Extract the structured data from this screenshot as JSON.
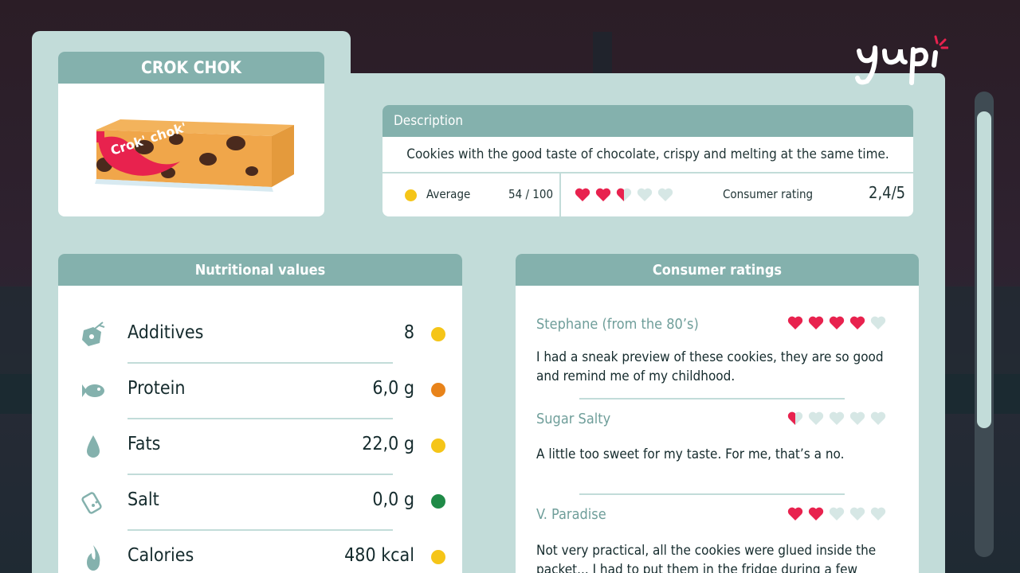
{
  "product": {
    "name": "CROK CHOK",
    "packaging_text": "Crok' chok'"
  },
  "logo": "yupi",
  "description": {
    "header": "Description",
    "text": "Cookies with the good taste of chocolate, crispy and melting at the same time.",
    "score_label": "Average",
    "score_value": "54 / 100",
    "score_color": "#f5c518",
    "consumer_rating_label": "Consumer rating",
    "consumer_rating_value": "2,4/5",
    "hearts": [
      1,
      1,
      0.5,
      0,
      0
    ]
  },
  "nutrition": {
    "header": "Nutritional values",
    "rows": [
      {
        "icon": "additives-icon",
        "label": "Additives",
        "value": "8",
        "color": "#f5c518"
      },
      {
        "icon": "fish-icon",
        "label": "Protein",
        "value": "6,0 g",
        "color": "#e8831a"
      },
      {
        "icon": "drop-icon",
        "label": "Fats",
        "value": "22,0 g",
        "color": "#f5c518"
      },
      {
        "icon": "salt-shaker-icon",
        "label": "Salt",
        "value": "0,0 g",
        "color": "#1f8a47"
      },
      {
        "icon": "flame-icon",
        "label": "Calories",
        "value": "480 kcal",
        "color": "#f5c518"
      }
    ]
  },
  "ratings": {
    "header": "Consumer ratings",
    "reviews": [
      {
        "name": "Stephane (from the 80’s)",
        "hearts": [
          1,
          1,
          1,
          1,
          0
        ],
        "text": "I had a sneak preview of these cookies, they are so good and remind me of my childhood."
      },
      {
        "name": "Sugar Salty",
        "hearts": [
          0.5,
          0,
          0,
          0,
          0
        ],
        "text": "A little too sweet for my taste. For me, that’s a no."
      },
      {
        "name": "V. Paradise",
        "hearts": [
          1,
          1,
          0,
          0,
          0
        ],
        "text": "Not very practical, all the cookies were glued inside the packet... I had to put them in the fridge during a few hours."
      }
    ]
  },
  "colors": {
    "panel": "#c2dcd9",
    "header": "#84b1ad",
    "heart_full": "#e8224e",
    "heart_empty": "#d6e7e5"
  }
}
